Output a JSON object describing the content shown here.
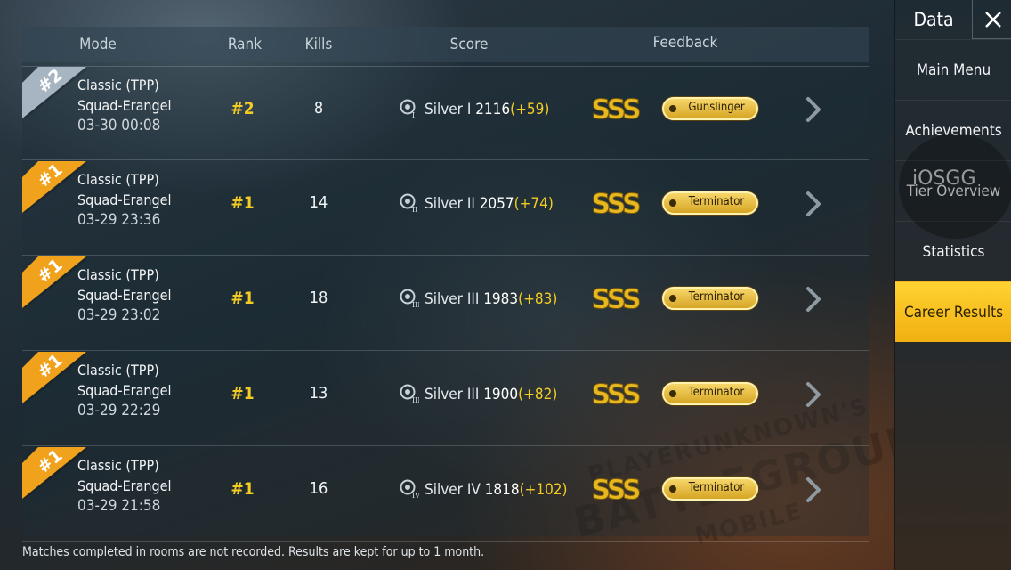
{
  "header": {
    "mode": "Mode",
    "rank": "Rank",
    "kills": "Kills",
    "score": "Score",
    "feedback": "Feedback"
  },
  "matches": [
    {
      "ribbon": "#2",
      "ribbon_color": "#a7b4c2",
      "mode": "Classic (TPP)",
      "map": "Squad-Erangel",
      "date": "03-30 00:08",
      "rank": "#2",
      "kills": "8",
      "tier": "Silver I",
      "tier_numeral": "I",
      "points": "2116",
      "delta": "(+59)",
      "grade": "SSS",
      "title": "Gunslinger"
    },
    {
      "ribbon": "#1",
      "ribbon_color": "#f0a21c",
      "mode": "Classic (TPP)",
      "map": "Squad-Erangel",
      "date": "03-29 23:36",
      "rank": "#1",
      "kills": "14",
      "tier": "Silver II",
      "tier_numeral": "II",
      "points": "2057",
      "delta": "(+74)",
      "grade": "SSS",
      "title": "Terminator"
    },
    {
      "ribbon": "#1",
      "ribbon_color": "#f0a21c",
      "mode": "Classic (TPP)",
      "map": "Squad-Erangel",
      "date": "03-29 23:02",
      "rank": "#1",
      "kills": "18",
      "tier": "Silver III",
      "tier_numeral": "III",
      "points": "1983",
      "delta": "(+83)",
      "grade": "SSS",
      "title": "Terminator"
    },
    {
      "ribbon": "#1",
      "ribbon_color": "#f0a21c",
      "mode": "Classic (TPP)",
      "map": "Squad-Erangel",
      "date": "03-29 22:29",
      "rank": "#1",
      "kills": "13",
      "tier": "Silver III",
      "tier_numeral": "III",
      "points": "1900",
      "delta": "(+82)",
      "grade": "SSS",
      "title": "Terminator"
    },
    {
      "ribbon": "#1",
      "ribbon_color": "#f0a21c",
      "mode": "Classic (TPP)",
      "map": "Squad-Erangel",
      "date": "03-29 21:58",
      "rank": "#1",
      "kills": "16",
      "tier": "Silver IV",
      "tier_numeral": "IV",
      "points": "1818",
      "delta": "(+102)",
      "grade": "SSS",
      "title": "Terminator"
    }
  ],
  "footnote": "Matches completed in rooms are not recorded. Results are kept for up to 1 month.",
  "sidebar": {
    "title": "Data",
    "items": [
      {
        "label": "Main Menu",
        "active": false
      },
      {
        "label": "Achievements",
        "active": false
      },
      {
        "label": "Tier Overview",
        "active": false
      },
      {
        "label": "Statistics",
        "active": false
      },
      {
        "label": "Career Results",
        "active": true
      }
    ]
  },
  "overlay_watermark": "iOSGG",
  "background_logo": [
    "PLAYERUNKNOWN'S",
    "BATTLEGROUNDS",
    "MOBILE"
  ],
  "colors": {
    "accent_yellow": "#f3cc23",
    "active_tab": "#ffd232",
    "rank2_ribbon": "#a7b4c2",
    "rank1_ribbon": "#f0a21c"
  }
}
